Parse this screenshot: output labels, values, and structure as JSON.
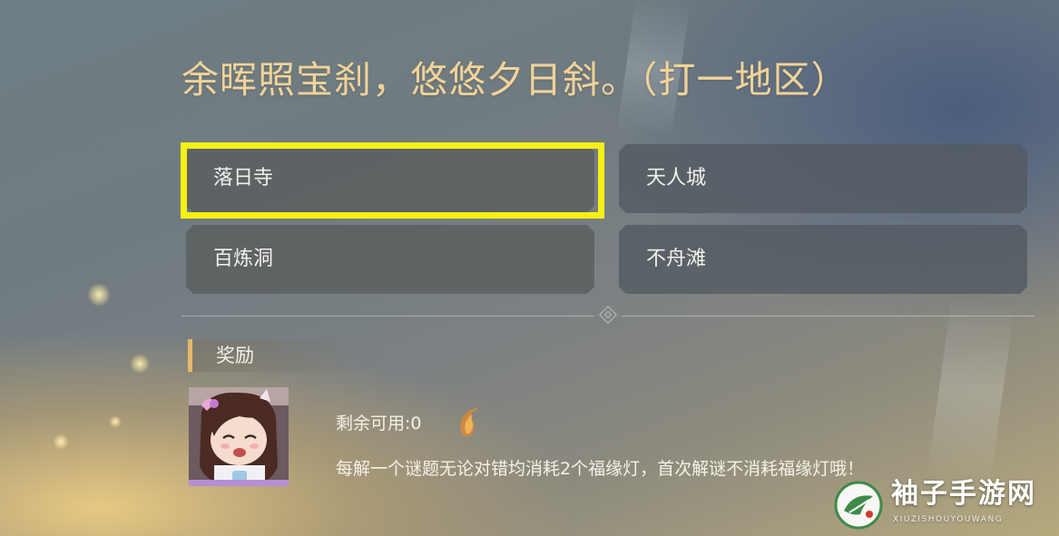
{
  "question": "余晖照宝刹，悠悠夕日斜。（打一地区）",
  "options": [
    {
      "label": "落日寺",
      "selected": true
    },
    {
      "label": "天人城",
      "selected": false
    },
    {
      "label": "百炼洞",
      "selected": false
    },
    {
      "label": "不舟滩",
      "selected": false
    }
  ],
  "reward": {
    "title": "奖励",
    "remaining_label": "剩余可用:0",
    "notice": "每解一个谜题无论对错均消耗2个福缘灯，首次解谜不消耗福缘灯哦！",
    "icon": "lamp-icon"
  },
  "watermark": {
    "title": "袖子手游网",
    "subtitle": "XIUZISHOUYOUWANG"
  },
  "colors": {
    "question": "#f1d39a",
    "selection_frame": "#f6f013",
    "reward_bar": "#e8b86a"
  }
}
